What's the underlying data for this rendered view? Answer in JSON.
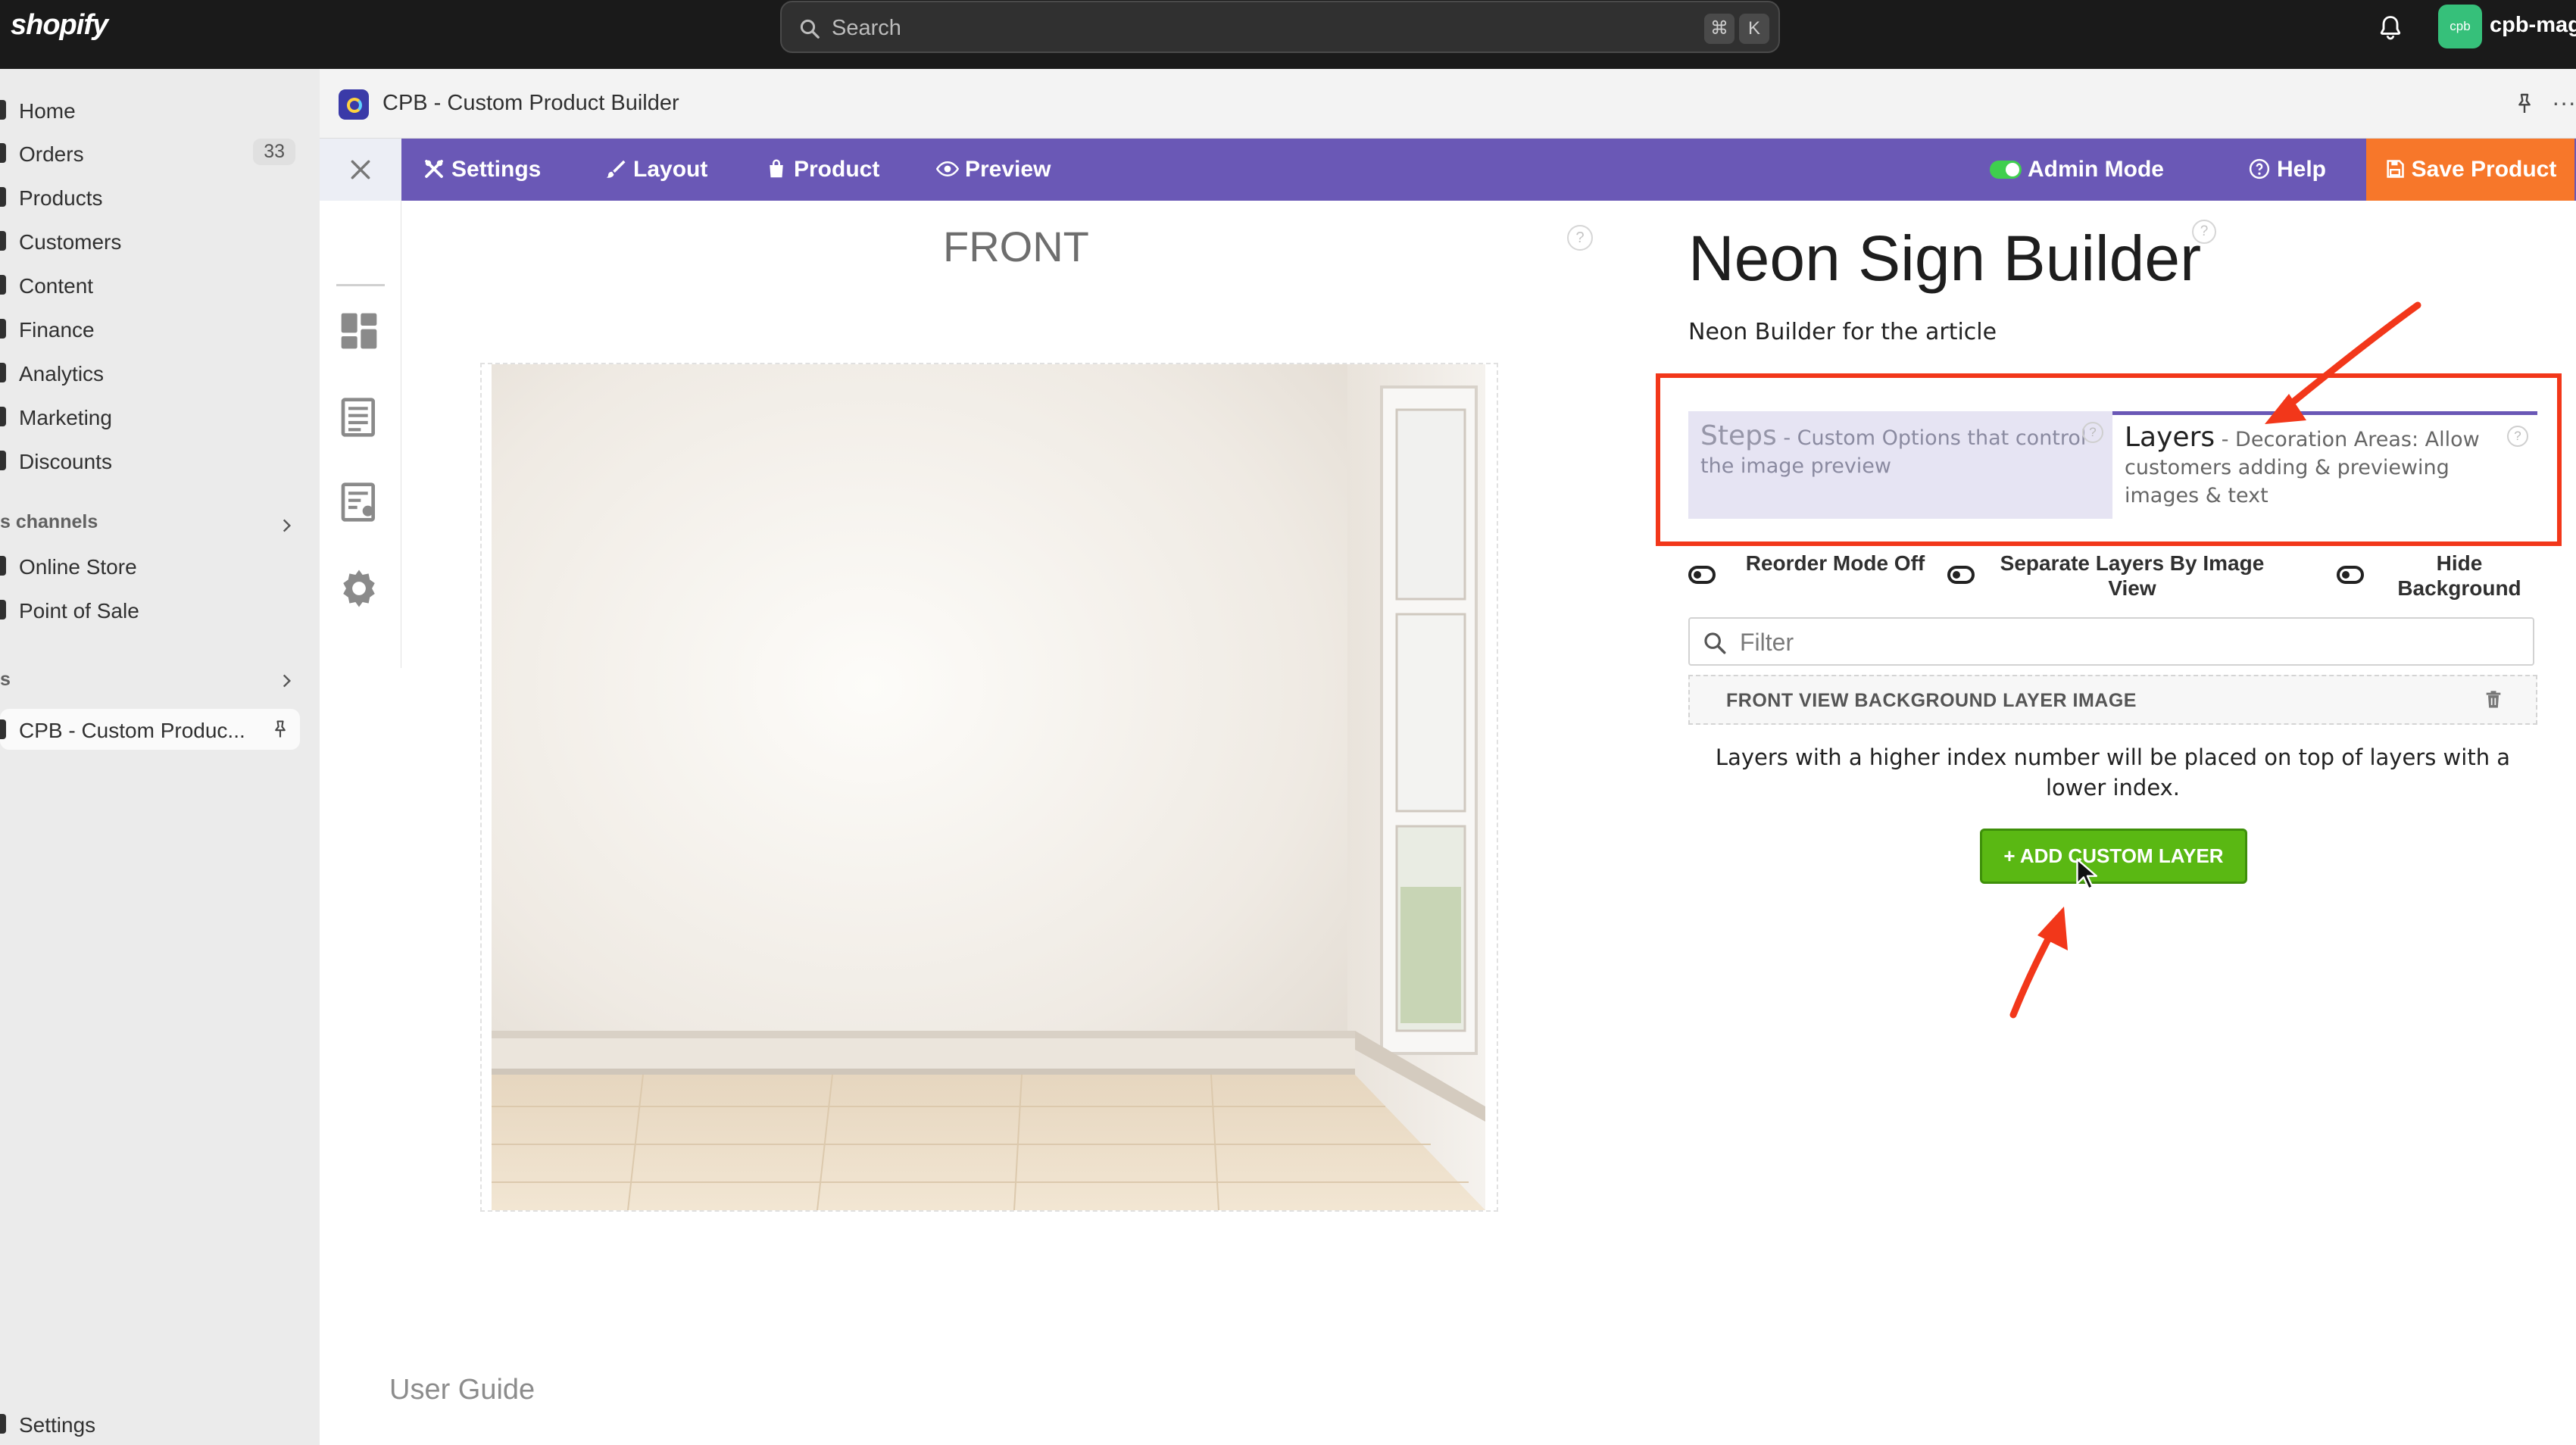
{
  "topbar": {
    "logo": "shopify",
    "search_placeholder": "Search",
    "shortcut_keys": [
      "⌘",
      "K"
    ],
    "avatar_initials": "cpb",
    "store_name": "cpb-mago"
  },
  "sidebar": {
    "items": [
      {
        "label": "Home"
      },
      {
        "label": "Orders",
        "count": "33"
      },
      {
        "label": "Products"
      },
      {
        "label": "Customers"
      },
      {
        "label": "Content"
      },
      {
        "label": "Finance"
      },
      {
        "label": "Analytics"
      },
      {
        "label": "Marketing"
      },
      {
        "label": "Discounts"
      }
    ],
    "channels_heading": "s channels",
    "channels": [
      {
        "label": "Online Store"
      },
      {
        "label": "Point of Sale"
      }
    ],
    "apps_heading": "s",
    "active_app": "CPB - Custom Produc...",
    "settings": "Settings"
  },
  "app": {
    "title": "CPB - Custom Product Builder",
    "more": "···",
    "toolbar": {
      "settings": "Settings",
      "layout": "Layout",
      "product": "Product",
      "preview": "Preview",
      "admin_mode": "Admin Mode",
      "help": "Help",
      "save": "Save Product"
    },
    "canvas": {
      "view_label": "FRONT",
      "user_guide": "User Guide",
      "help_glyph": "?"
    },
    "panel": {
      "product_title": "Neon Sign Builder",
      "product_description": "Neon Builder for the article",
      "tabs": [
        {
          "name": "Steps",
          "description": " - Custom Options that control the image preview"
        },
        {
          "name": "Layers",
          "description": " - Decoration Areas: Allow customers adding & previewing images & text"
        }
      ],
      "toggles": [
        {
          "label": "Reorder Mode Off"
        },
        {
          "label": "Separate Layers By Image View"
        },
        {
          "label": "Hide Background"
        }
      ],
      "filter_placeholder": "Filter",
      "layers": [
        {
          "name": "FRONT VIEW BACKGROUND LAYER IMAGE"
        }
      ],
      "layers_note": "Layers with a higher index number will be placed on top of layers with a lower index.",
      "add_layer_button": "+ ADD CUSTOM LAYER"
    }
  },
  "colors": {
    "toolbar_purple": "#6a58b6",
    "save_orange": "#f7772a",
    "add_green": "#5ab813",
    "annotation_red": "#f2371a"
  }
}
